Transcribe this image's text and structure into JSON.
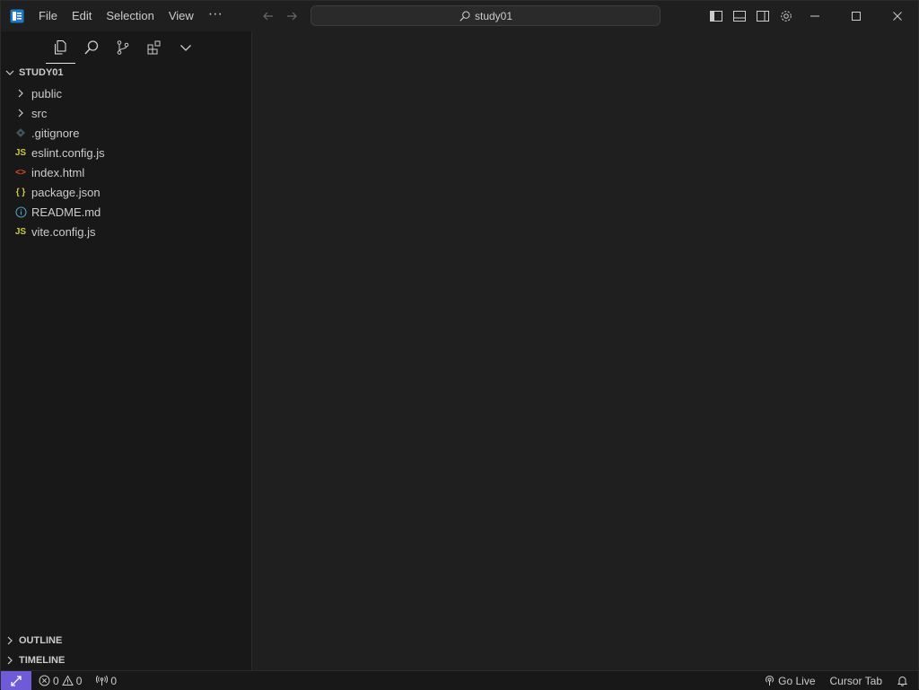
{
  "titlebar": {
    "menu": [
      "File",
      "Edit",
      "Selection",
      "View"
    ],
    "more": "···",
    "search_text": "study01"
  },
  "explorer": {
    "root_label": "STUDY01",
    "items": [
      {
        "label": "public",
        "kind": "folder"
      },
      {
        "label": "src",
        "kind": "folder"
      },
      {
        "label": ".gitignore",
        "kind": "git"
      },
      {
        "label": "eslint.config.js",
        "kind": "js",
        "badge": "JS"
      },
      {
        "label": "index.html",
        "kind": "html",
        "badge": "<>"
      },
      {
        "label": "package.json",
        "kind": "json",
        "badge": "{ }"
      },
      {
        "label": "README.md",
        "kind": "info"
      },
      {
        "label": "vite.config.js",
        "kind": "js",
        "badge": "JS"
      }
    ],
    "outline_label": "OUTLINE",
    "timeline_label": "TIMELINE"
  },
  "statusbar": {
    "errors": "0",
    "warnings": "0",
    "ports": "0",
    "go_live": "Go Live",
    "cursor_tab": "Cursor Tab"
  },
  "colors": {
    "accent_remote": "#6f5bd8",
    "js_badge": "#cbcb41",
    "html_badge": "#e44d26",
    "json_badge": "#cbcb41",
    "info_icon": "#519aba"
  }
}
